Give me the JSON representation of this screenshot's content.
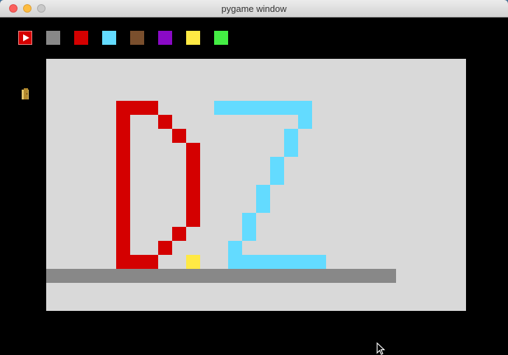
{
  "window": {
    "title": "pygame window"
  },
  "palette": {
    "items": [
      {
        "name": "play",
        "color": "#d40000"
      },
      {
        "name": "gray",
        "color": "#888888"
      },
      {
        "name": "red",
        "color": "#d40000"
      },
      {
        "name": "cyan",
        "color": "#63dbff"
      },
      {
        "name": "brown",
        "color": "#7a4f2d"
      },
      {
        "name": "purple",
        "color": "#8a0ac6"
      },
      {
        "name": "yellow",
        "color": "#ffe944"
      },
      {
        "name": "green",
        "color": "#44ee44"
      }
    ]
  },
  "canvas": {
    "background": "#d9d9d9",
    "cell_grid": "20",
    "colors": {
      "red": "#d40000",
      "cyan": "#63dbff",
      "yellow": "#ffe944",
      "gray": "#888888"
    }
  }
}
